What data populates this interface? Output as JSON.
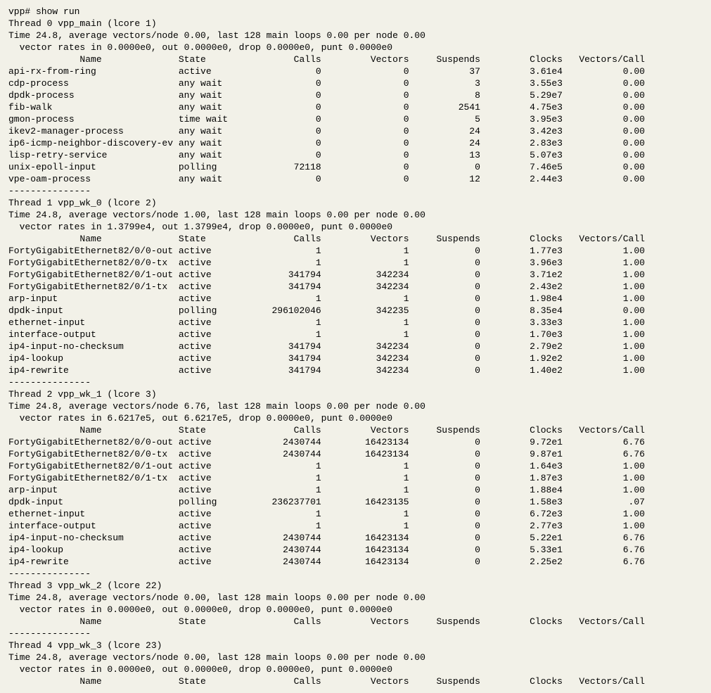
{
  "prompt": "vpp# show run",
  "col_headers": {
    "name": "Name",
    "state": "State",
    "calls": "Calls",
    "vectors": "Vectors",
    "suspends": "Suspends",
    "clocks": "Clocks",
    "vpc": "Vectors/Call"
  },
  "separator": "---------------",
  "threads": [
    {
      "title": "Thread 0 vpp_main (lcore 1)",
      "time_line": "Time 24.8, average vectors/node 0.00, last 128 main loops 0.00 per node 0.00",
      "rate_line": "  vector rates in 0.0000e0, out 0.0000e0, drop 0.0000e0, punt 0.0000e0",
      "rows": [
        {
          "name": "api-rx-from-ring",
          "state": "active",
          "calls": "0",
          "vectors": "0",
          "suspends": "37",
          "clocks": "3.61e4",
          "vpc": "0.00"
        },
        {
          "name": "cdp-process",
          "state": "any wait",
          "calls": "0",
          "vectors": "0",
          "suspends": "3",
          "clocks": "3.55e3",
          "vpc": "0.00"
        },
        {
          "name": "dpdk-process",
          "state": "any wait",
          "calls": "0",
          "vectors": "0",
          "suspends": "8",
          "clocks": "5.29e7",
          "vpc": "0.00"
        },
        {
          "name": "fib-walk",
          "state": "any wait",
          "calls": "0",
          "vectors": "0",
          "suspends": "2541",
          "clocks": "4.75e3",
          "vpc": "0.00"
        },
        {
          "name": "gmon-process",
          "state": "time wait",
          "calls": "0",
          "vectors": "0",
          "suspends": "5",
          "clocks": "3.95e3",
          "vpc": "0.00"
        },
        {
          "name": "ikev2-manager-process",
          "state": "any wait",
          "calls": "0",
          "vectors": "0",
          "suspends": "24",
          "clocks": "3.42e3",
          "vpc": "0.00"
        },
        {
          "name": "ip6-icmp-neighbor-discovery-ev",
          "state": "any wait",
          "calls": "0",
          "vectors": "0",
          "suspends": "24",
          "clocks": "2.83e3",
          "vpc": "0.00"
        },
        {
          "name": "lisp-retry-service",
          "state": "any wait",
          "calls": "0",
          "vectors": "0",
          "suspends": "13",
          "clocks": "5.07e3",
          "vpc": "0.00"
        },
        {
          "name": "unix-epoll-input",
          "state": "polling",
          "calls": "72118",
          "vectors": "0",
          "suspends": "0",
          "clocks": "7.46e5",
          "vpc": "0.00"
        },
        {
          "name": "vpe-oam-process",
          "state": "any wait",
          "calls": "0",
          "vectors": "0",
          "suspends": "12",
          "clocks": "2.44e3",
          "vpc": "0.00"
        }
      ]
    },
    {
      "title": "Thread 1 vpp_wk_0 (lcore 2)",
      "time_line": "Time 24.8, average vectors/node 1.00, last 128 main loops 0.00 per node 0.00",
      "rate_line": "  vector rates in 1.3799e4, out 1.3799e4, drop 0.0000e0, punt 0.0000e0",
      "rows": [
        {
          "name": "FortyGigabitEthernet82/0/0-out",
          "state": "active",
          "calls": "1",
          "vectors": "1",
          "suspends": "0",
          "clocks": "1.77e3",
          "vpc": "1.00"
        },
        {
          "name": "FortyGigabitEthernet82/0/0-tx",
          "state": "active",
          "calls": "1",
          "vectors": "1",
          "suspends": "0",
          "clocks": "3.96e3",
          "vpc": "1.00"
        },
        {
          "name": "FortyGigabitEthernet82/0/1-out",
          "state": "active",
          "calls": "341794",
          "vectors": "342234",
          "suspends": "0",
          "clocks": "3.71e2",
          "vpc": "1.00"
        },
        {
          "name": "FortyGigabitEthernet82/0/1-tx",
          "state": "active",
          "calls": "341794",
          "vectors": "342234",
          "suspends": "0",
          "clocks": "2.43e2",
          "vpc": "1.00"
        },
        {
          "name": "arp-input",
          "state": "active",
          "calls": "1",
          "vectors": "1",
          "suspends": "0",
          "clocks": "1.98e4",
          "vpc": "1.00"
        },
        {
          "name": "dpdk-input",
          "state": "polling",
          "calls": "296102046",
          "vectors": "342235",
          "suspends": "0",
          "clocks": "8.35e4",
          "vpc": "0.00"
        },
        {
          "name": "ethernet-input",
          "state": "active",
          "calls": "1",
          "vectors": "1",
          "suspends": "0",
          "clocks": "3.33e3",
          "vpc": "1.00"
        },
        {
          "name": "interface-output",
          "state": "active",
          "calls": "1",
          "vectors": "1",
          "suspends": "0",
          "clocks": "1.70e3",
          "vpc": "1.00"
        },
        {
          "name": "ip4-input-no-checksum",
          "state": "active",
          "calls": "341794",
          "vectors": "342234",
          "suspends": "0",
          "clocks": "2.79e2",
          "vpc": "1.00"
        },
        {
          "name": "ip4-lookup",
          "state": "active",
          "calls": "341794",
          "vectors": "342234",
          "suspends": "0",
          "clocks": "1.92e2",
          "vpc": "1.00"
        },
        {
          "name": "ip4-rewrite",
          "state": "active",
          "calls": "341794",
          "vectors": "342234",
          "suspends": "0",
          "clocks": "1.40e2",
          "vpc": "1.00"
        }
      ]
    },
    {
      "title": "Thread 2 vpp_wk_1 (lcore 3)",
      "time_line": "Time 24.8, average vectors/node 6.76, last 128 main loops 0.00 per node 0.00",
      "rate_line": "  vector rates in 6.6217e5, out 6.6217e5, drop 0.0000e0, punt 0.0000e0",
      "rows": [
        {
          "name": "FortyGigabitEthernet82/0/0-out",
          "state": "active",
          "calls": "2430744",
          "vectors": "16423134",
          "suspends": "0",
          "clocks": "9.72e1",
          "vpc": "6.76"
        },
        {
          "name": "FortyGigabitEthernet82/0/0-tx",
          "state": "active",
          "calls": "2430744",
          "vectors": "16423134",
          "suspends": "0",
          "clocks": "9.87e1",
          "vpc": "6.76"
        },
        {
          "name": "FortyGigabitEthernet82/0/1-out",
          "state": "active",
          "calls": "1",
          "vectors": "1",
          "suspends": "0",
          "clocks": "1.64e3",
          "vpc": "1.00"
        },
        {
          "name": "FortyGigabitEthernet82/0/1-tx",
          "state": "active",
          "calls": "1",
          "vectors": "1",
          "suspends": "0",
          "clocks": "1.87e3",
          "vpc": "1.00"
        },
        {
          "name": "arp-input",
          "state": "active",
          "calls": "1",
          "vectors": "1",
          "suspends": "0",
          "clocks": "1.88e4",
          "vpc": "1.00"
        },
        {
          "name": "dpdk-input",
          "state": "polling",
          "calls": "236237701",
          "vectors": "16423135",
          "suspends": "0",
          "clocks": "1.58e3",
          "vpc": ".07"
        },
        {
          "name": "ethernet-input",
          "state": "active",
          "calls": "1",
          "vectors": "1",
          "suspends": "0",
          "clocks": "6.72e3",
          "vpc": "1.00"
        },
        {
          "name": "interface-output",
          "state": "active",
          "calls": "1",
          "vectors": "1",
          "suspends": "0",
          "clocks": "2.77e3",
          "vpc": "1.00"
        },
        {
          "name": "ip4-input-no-checksum",
          "state": "active",
          "calls": "2430744",
          "vectors": "16423134",
          "suspends": "0",
          "clocks": "5.22e1",
          "vpc": "6.76"
        },
        {
          "name": "ip4-lookup",
          "state": "active",
          "calls": "2430744",
          "vectors": "16423134",
          "suspends": "0",
          "clocks": "5.33e1",
          "vpc": "6.76"
        },
        {
          "name": "ip4-rewrite",
          "state": "active",
          "calls": "2430744",
          "vectors": "16423134",
          "suspends": "0",
          "clocks": "2.25e2",
          "vpc": "6.76"
        }
      ]
    },
    {
      "title": "Thread 3 vpp_wk_2 (lcore 22)",
      "time_line": "Time 24.8, average vectors/node 0.00, last 128 main loops 0.00 per node 0.00",
      "rate_line": "  vector rates in 0.0000e0, out 0.0000e0, drop 0.0000e0, punt 0.0000e0",
      "rows": []
    },
    {
      "title": "Thread 4 vpp_wk_3 (lcore 23)",
      "time_line": "Time 24.8, average vectors/node 0.00, last 128 main loops 0.00 per node 0.00",
      "rate_line": "  vector rates in 0.0000e0, out 0.0000e0, drop 0.0000e0, punt 0.0000e0",
      "rows": []
    }
  ]
}
